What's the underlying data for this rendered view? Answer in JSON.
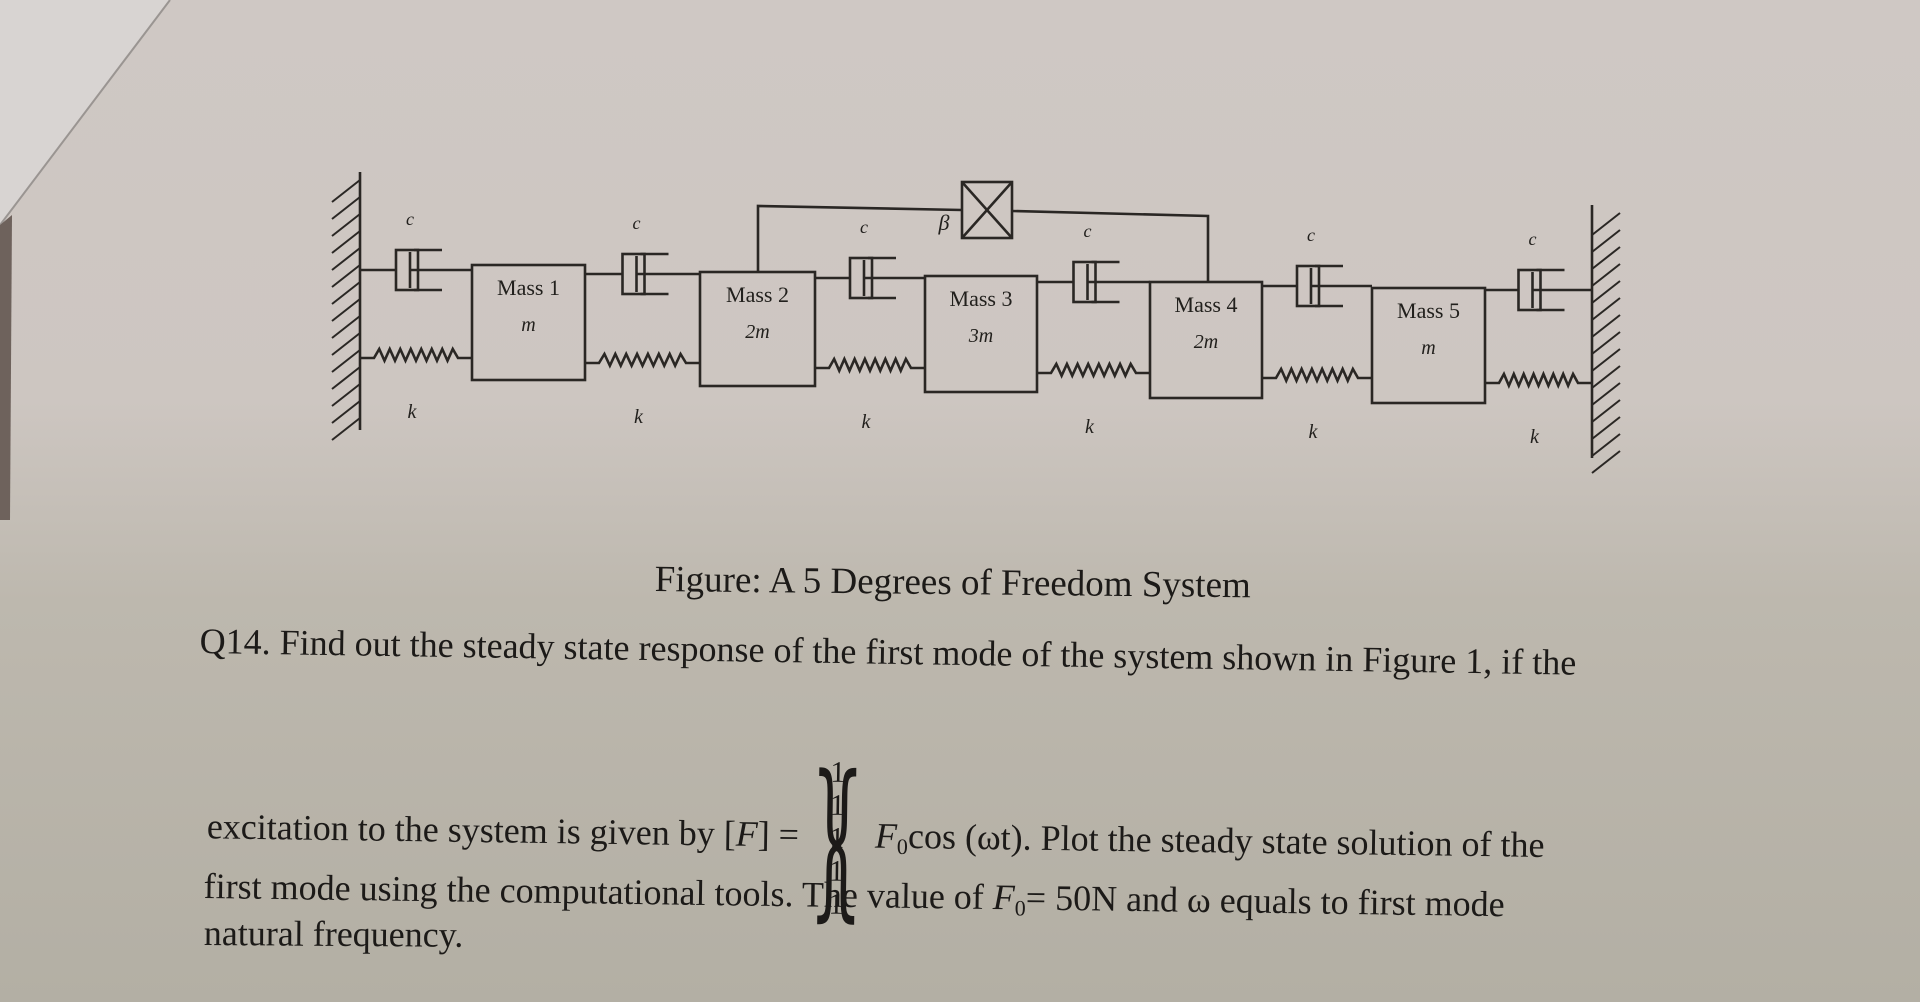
{
  "diagram": {
    "masses": [
      {
        "label": "Mass 1",
        "mass": "m"
      },
      {
        "label": "Mass 2",
        "mass": "2m"
      },
      {
        "label": "Mass 3",
        "mass": "3m"
      },
      {
        "label": "Mass 4",
        "mass": "2m"
      },
      {
        "label": "Mass 5",
        "mass": "m"
      }
    ],
    "damper_label": "c",
    "spring_label": "k",
    "nonlinear_element_label": "β",
    "caption": "Figure: A 5 Degrees of Freedom System"
  },
  "question": {
    "line1": "Q14. Find out the steady state response of the first mode of the system shown in Figure 1, if the",
    "line2_prefix": "excitation to the system is given by [",
    "line2_F": "F",
    "line2_eq": "] =",
    "force_vector": [
      "1",
      "1",
      "1",
      "1",
      "1"
    ],
    "line2_F0": "F",
    "line2_F0_sub": "0",
    "line2_suffix": "cos (ωt). Plot the steady state solution of the",
    "line3_prefix": "first mode using the computational tools. The value of ",
    "line3_F": "F",
    "line3_F_sub": "0",
    "line3_suffix": "= 50N and ω equals to first mode",
    "line4": "natural frequency."
  }
}
